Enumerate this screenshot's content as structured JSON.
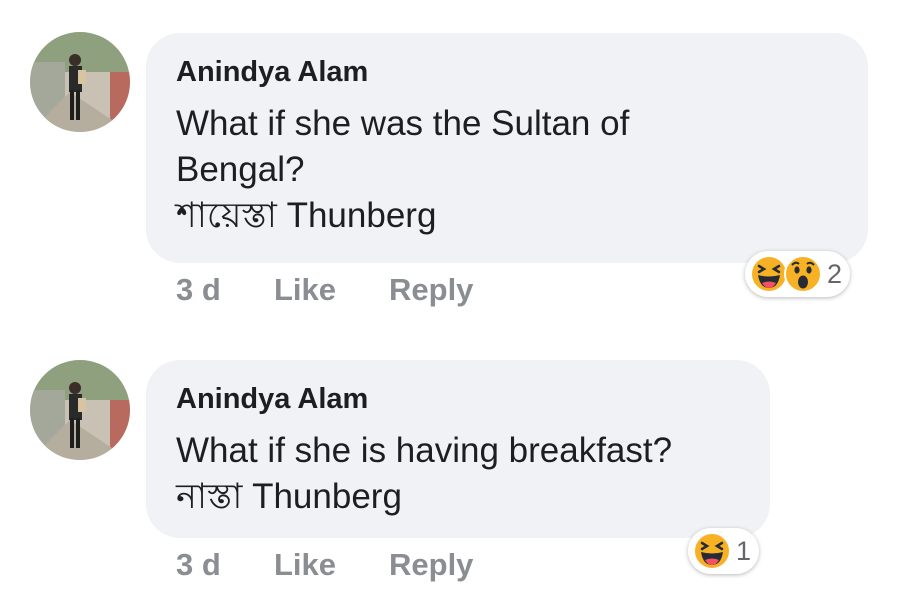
{
  "comments": [
    {
      "author": "Anindya Alam",
      "lines": [
        "What if she was the Sultan of",
        "Bengal?",
        "শায়েস্তা Thunberg"
      ],
      "time": "3 d",
      "like_label": "Like",
      "reply_label": "Reply",
      "reactions": [
        "haha",
        "wow"
      ],
      "reaction_count": "2"
    },
    {
      "author": "Anindya Alam",
      "lines": [
        "What if she is having breakfast?",
        "নাস্তা Thunberg"
      ],
      "time": "3 d",
      "like_label": "Like",
      "reply_label": "Reply",
      "reactions": [
        "haha"
      ],
      "reaction_count": "1"
    }
  ],
  "colors": {
    "bubble_bg": "#f0f2f5",
    "text": "#1c1e21",
    "meta": "#8a8d91",
    "emoji_yellow": "#f7b125"
  }
}
